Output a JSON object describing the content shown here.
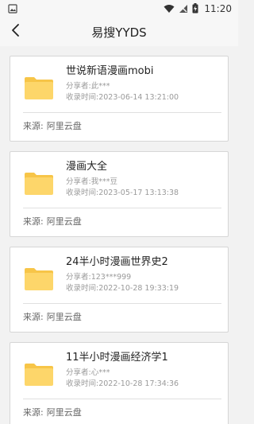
{
  "status_bar": {
    "time": "11:20"
  },
  "header": {
    "title": "易搜YYDS"
  },
  "items": [
    {
      "title": "世说新语漫画mobi",
      "sharer_label": "分享者:",
      "sharer": "此***",
      "time_label": "收录时间:",
      "time": "2023-06-14 13:21:00",
      "source_label": "来源:",
      "source": "阿里云盘"
    },
    {
      "title": "漫画大全",
      "sharer_label": "分享者:",
      "sharer": "我***豆",
      "time_label": "收录时间:",
      "time": "2023-05-17 13:13:38",
      "source_label": "来源:",
      "source": "阿里云盘"
    },
    {
      "title": "24半小时漫画世界史2",
      "sharer_label": "分享者:",
      "sharer": "123***999",
      "time_label": "收录时间:",
      "time": "2022-10-28 19:33:19",
      "source_label": "来源:",
      "source": "阿里云盘"
    },
    {
      "title": "11半小时漫画经济学1",
      "sharer_label": "分享者:",
      "sharer": "心***",
      "time_label": "收录时间:",
      "time": "2022-10-28 17:34:36",
      "source_label": "来源:",
      "source": "阿里云盘"
    }
  ],
  "icons": {
    "status_left": "image-notification-icon",
    "wifi": "wifi-icon",
    "signal": "no-sim-signal-icon",
    "battery": "battery-charging-icon",
    "back": "back-arrow-icon",
    "folder": "folder-icon"
  },
  "colors": {
    "folder": "#fdd66a",
    "folder_tab": "#f7c548",
    "background": "#f2f2f2",
    "meta_text": "#9a9a9a"
  }
}
